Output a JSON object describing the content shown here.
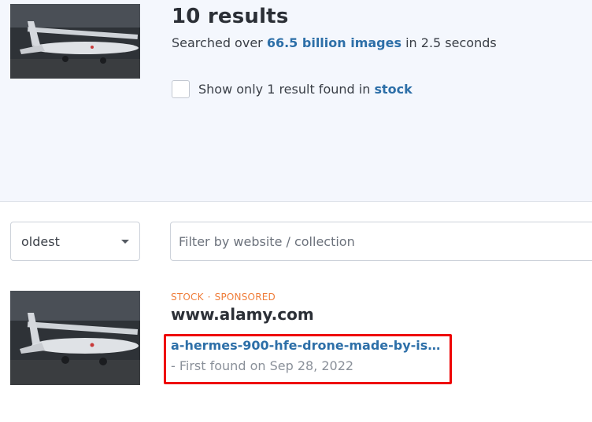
{
  "summary": {
    "results_count": "10 results",
    "searched_prefix": "Searched over",
    "searched_count": "66.5 billion images",
    "searched_suffix": "in 2.5 seconds"
  },
  "stock_filter": {
    "checked": false,
    "label_prefix": "Show only 1 result found in",
    "label_link": "stock"
  },
  "controls": {
    "sort_value": "oldest",
    "filter_placeholder": "Filter by website / collection"
  },
  "result": {
    "tag_stock": "STOCK",
    "tag_separator": "·",
    "tag_sponsored": "SPONSORED",
    "domain": "www.alamy.com",
    "link": "a-hermes-900-hfe-drone-made-by-israe...",
    "first_found": "- First found on Sep 28, 2022"
  },
  "icons": {
    "query_image": "drone-thumbnail",
    "result_image": "drone-thumbnail",
    "sort_caret": "caret-down-icon"
  },
  "colors": {
    "accent_link": "#2d6fa8",
    "tag_orange": "#ef7d3a",
    "highlight_red": "#ee0000",
    "header_bg": "#f4f7fd"
  }
}
